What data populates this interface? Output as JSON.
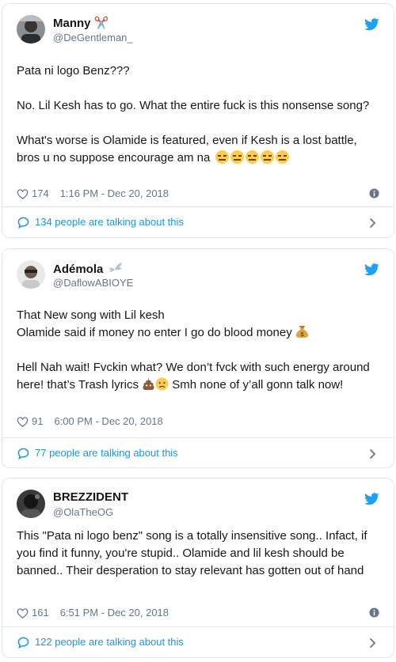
{
  "tweets": [
    {
      "name": "Manny ✂️",
      "handle": "@DeGentleman_",
      "paragraphs": [
        "Pata ni logo Benz???",
        "No. Lil Kesh has to go. What the entire fuck is this nonsense song?",
        "What's worse is Olamide is featured, even if Kesh is a lost battle, bros u no suppose encourage am na"
      ],
      "likes": "174",
      "time": "1:16 PM - Dec 20, 2018",
      "talking": "134 people are talking about this"
    },
    {
      "name": "Adémola",
      "handle": "@DaflowABIOYE",
      "line1": "That New song with Lil kesh",
      "line2": "Olamide said if money no enter I go do blood money",
      "para3": "Hell Nah wait! Fvckin what? We don’t fvck with such energy around here! that’s Trash lyrics",
      "para3b": "Smh none of y’all gonn talk now!",
      "likes": "91",
      "time": "6:00 PM - Dec 20, 2018",
      "talking": "77 people are talking about this"
    },
    {
      "name": "BREZZIDENT",
      "handle": "@OlaTheOG",
      "text": "This \"Pata ni logo benz\" song is a totally insensitive song.. Infact, if you find it funny, you're stupid.. Olamide and lil kesh should be banned.. Their desperation to stay relevant has gotten out of hand",
      "likes": "161",
      "time": "6:51 PM - Dec 20, 2018",
      "talking": "122 people are talking about this"
    }
  ],
  "colors": {
    "accent": "#1da1f2",
    "link": "#1b95e0",
    "muted": "#657786",
    "border": "#e1e8ed"
  },
  "icons": [
    "twitter-bird-icon",
    "heart-icon",
    "info-icon",
    "speech-bubble-icon",
    "chevron-right-icon",
    "money-bag-emoji",
    "poop-emoji",
    "worried-face-emoji",
    "expressionless-face-emoji"
  ]
}
